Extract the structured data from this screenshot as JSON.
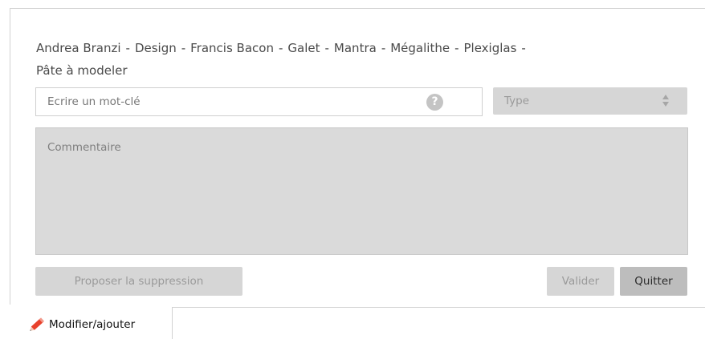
{
  "tags": {
    "items": [
      "Andrea Branzi",
      "Design",
      "Francis Bacon",
      "Galet",
      "Mantra",
      "Mégalithe",
      "Plexiglas",
      "Pâte à modeler"
    ],
    "separator": "-"
  },
  "keyword": {
    "placeholder": "Ecrire un mot-clé",
    "value": "",
    "help_icon": "?"
  },
  "type_select": {
    "label": "Type"
  },
  "comment": {
    "placeholder": "Commentaire",
    "value": ""
  },
  "buttons": {
    "propose_delete": "Proposer la suppression",
    "validate": "Valider",
    "quit": "Quitter"
  },
  "tab": {
    "label": "Modifier/ajouter",
    "icon": "pencil-icon"
  },
  "colors": {
    "pencil": "#e8412c",
    "disabled_bg": "#d6d6d6",
    "disabled_text": "#9a9a9a"
  }
}
